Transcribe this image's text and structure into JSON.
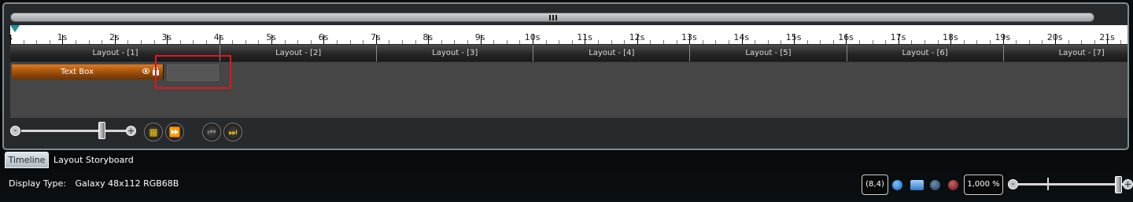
{
  "ruler": {
    "labels": [
      "s",
      "1s",
      "2s",
      "3s",
      "4s",
      "5s",
      "6s",
      "7s",
      "8s",
      "9s",
      "10s",
      "11s",
      "12s",
      "13s",
      "14s",
      "15s",
      "16s",
      "17s",
      "18s",
      "19s",
      "20s",
      "21s"
    ]
  },
  "layouts": [
    "Layout - [1]",
    "Layout - [2]",
    "Layout - [3]",
    "Layout - [4]",
    "Layout - [5]",
    "Layout - [6]",
    "Layout - [7]"
  ],
  "track": {
    "label": "Text Box"
  },
  "controls": {
    "minus": "-",
    "plus": "+"
  },
  "tabs": {
    "timeline": "Timeline",
    "storyboard": "Layout Storyboard"
  },
  "status": {
    "display_type_label": "Display Type:",
    "display_type_value": "Galaxy 48x112 RGB68B",
    "coordinates": "(8,4)",
    "zoom": "1,000 %"
  },
  "colors": {
    "track_item": "#c0620f",
    "playhead": "#1e8e99",
    "play_controls": "#f5c400",
    "highlight": "#e0171c"
  },
  "icons": {
    "track_visibility": "eye-icon",
    "track_lock": "lock-icon",
    "storyboard": "filmstrip-icon",
    "fast_forward": "fast-forward-icon",
    "prev": "skip-back-icon",
    "next": "skip-forward-icon"
  }
}
